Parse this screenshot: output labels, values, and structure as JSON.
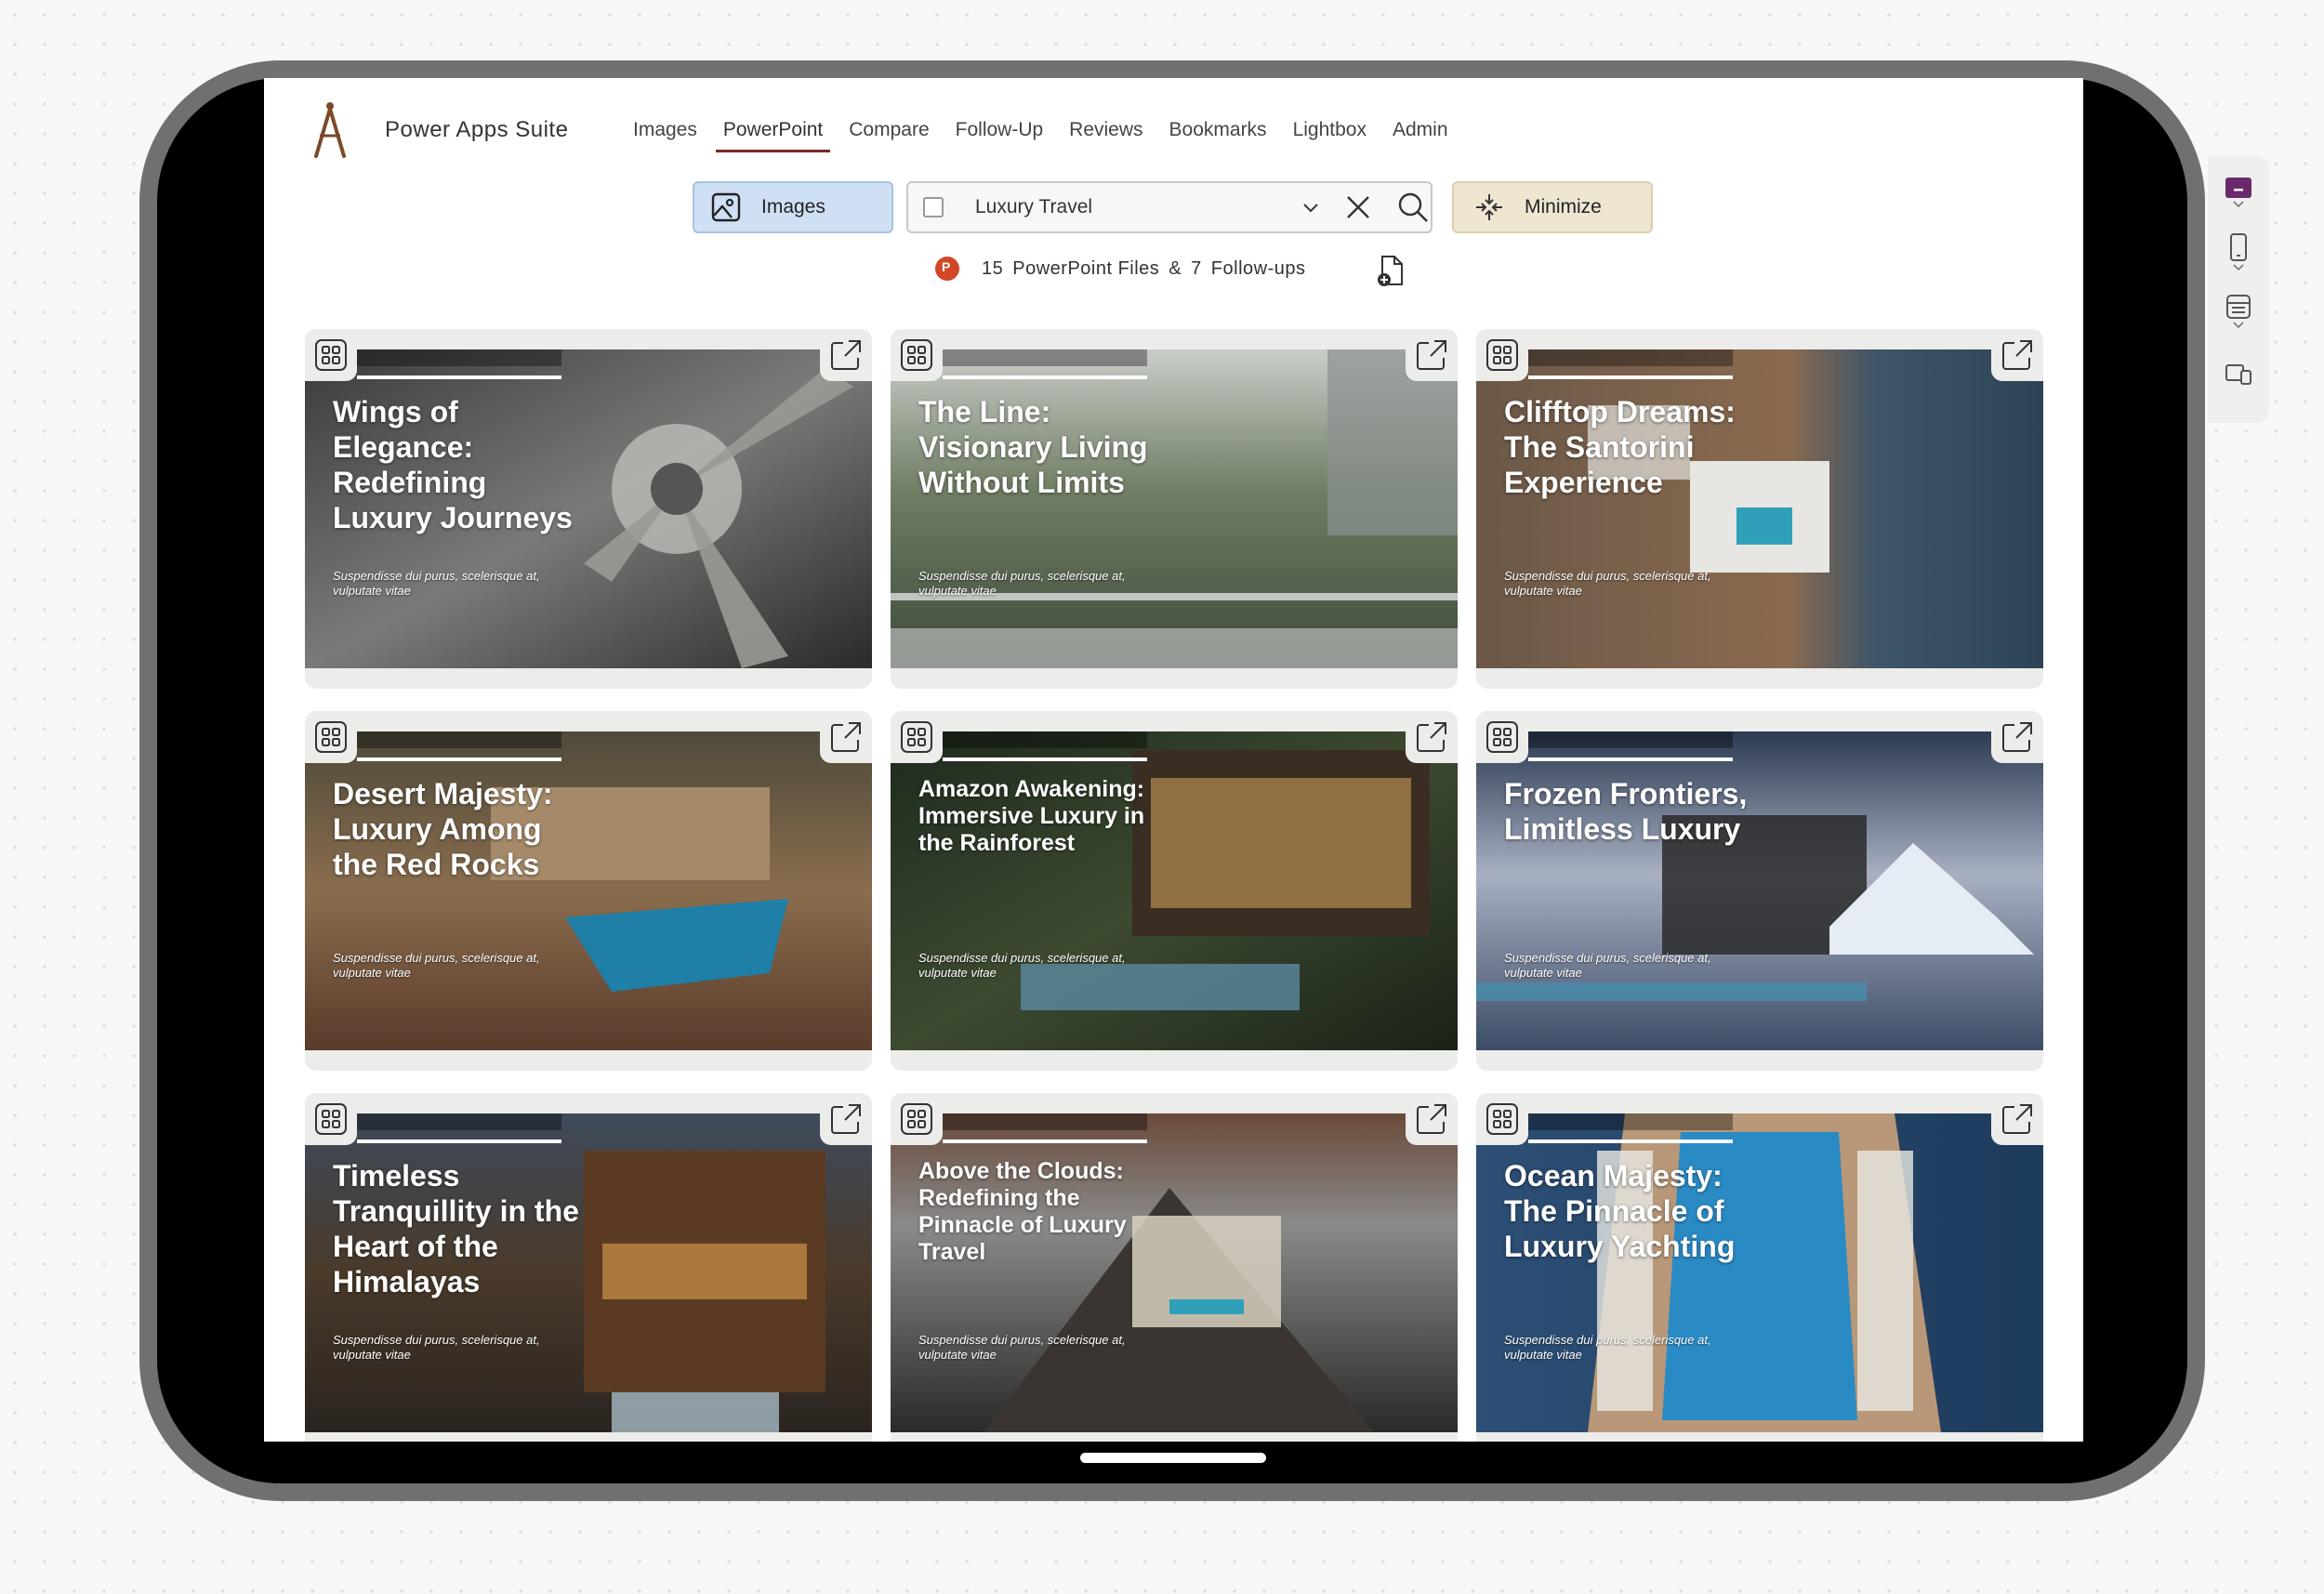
{
  "app": {
    "title": "Power Apps Suite"
  },
  "nav": [
    {
      "label": "Images"
    },
    {
      "label": "PowerPoint",
      "active": true
    },
    {
      "label": "Compare"
    },
    {
      "label": "Follow-Up"
    },
    {
      "label": "Reviews"
    },
    {
      "label": "Bookmarks"
    },
    {
      "label": "Lightbox"
    },
    {
      "label": "Admin"
    }
  ],
  "toolbar": {
    "images_label": "Images",
    "search_value": "Luxury Travel",
    "minimize_label": "Minimize"
  },
  "summary": {
    "ppt_count": "15",
    "ppt_label": "PowerPoint Files",
    "amp": "&",
    "followup_count": "7",
    "followup_label": "Follow-ups"
  },
  "cards": [
    {
      "title": "Wings of Elegance: Redefining Luxury Journeys",
      "subtitle": "Suspendisse dui purus, scelerisque at, vulputate vitae"
    },
    {
      "title": "The Line: Visionary Living Without Limits",
      "subtitle": "Suspendisse dui purus, scelerisque at, vulputate vitae"
    },
    {
      "title": "Clifftop Dreams: The Santorini Experience",
      "subtitle": "Suspendisse dui purus, scelerisque at, vulputate vitae"
    },
    {
      "title": "Desert Majesty: Luxury Among the Red Rocks",
      "subtitle": "Suspendisse dui purus, scelerisque at, vulputate vitae"
    },
    {
      "title": "Amazon Awakening: Immersive Luxury in the Rainforest",
      "subtitle": "Suspendisse dui purus, scelerisque at, vulputate vitae"
    },
    {
      "title": "Frozen Frontiers, Limitless Luxury",
      "subtitle": "Suspendisse dui purus, scelerisque at, vulputate vitae"
    },
    {
      "title": "Timeless Tranquillity in the Heart of the Himalayas",
      "subtitle": "Suspendisse dui purus, scelerisque at, vulputate vitae"
    },
    {
      "title": "Above the Clouds: Redefining the Pinnacle of Luxury Travel",
      "subtitle": "Suspendisse dui purus, scelerisque at, vulputate vitae"
    },
    {
      "title": "Ocean Majesty: The Pinnacle of Luxury Yachting",
      "subtitle": "Suspendisse dui purus, scelerisque at, vulputate vitae"
    }
  ],
  "colors": {
    "nav_active_underline": "#7a2b2b",
    "images_button_bg": "#cfe0f4",
    "minimize_button_bg": "#efe6d2",
    "side_panel_accent": "#6b2a6b"
  }
}
